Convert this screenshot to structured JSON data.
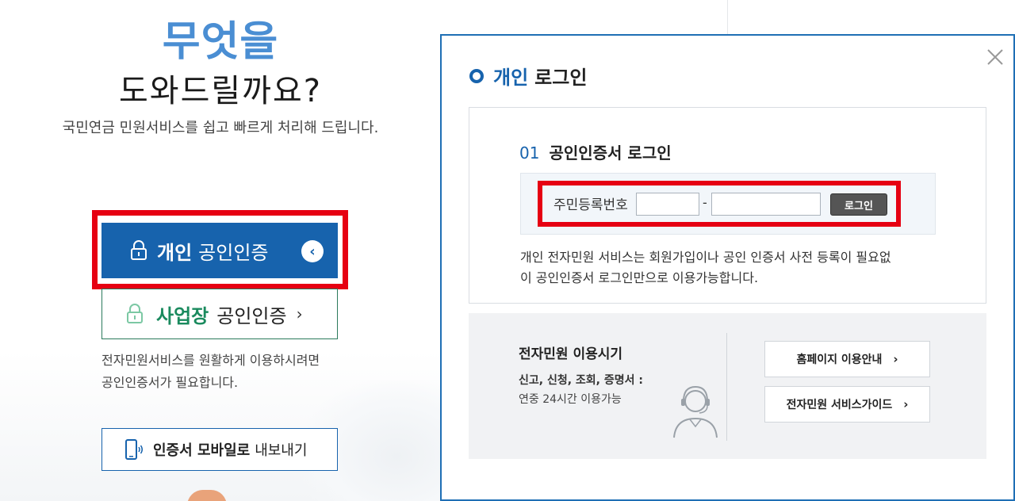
{
  "hero": {
    "title_line1": "무엇을",
    "title_line2": "도와드릴까요?",
    "subtitle": "국민연금 민원서비스를 쉽고 빠르게 처리해 드립니다."
  },
  "buttons": {
    "personal_bold": "개인",
    "personal_label": "공인인증",
    "business_bold": "사업장",
    "business_label": "공인인증",
    "business_chevron": "›",
    "mobile_bold": "인증서 모바일로",
    "mobile_label": "내보내기"
  },
  "left_note": {
    "line1": "전자민원서비스를 원활하게 이용하시려면",
    "line2": "공인인증서가 필요합니다."
  },
  "modal": {
    "title_accent": "개인",
    "title_rest": "로그인",
    "section_number": "01",
    "section_title": "공인인증서 로그인",
    "id_label": "주민등록번호",
    "id_dash": "-",
    "login_button": "로그인",
    "description_line1": "개인 전자민원 서비스는 회원가입이나 공인 인증서 사전 등록이 필요없",
    "description_line2": "이 공인인증서 로그인만으로 이용가능합니다.",
    "id_part1_value": "",
    "id_part2_value": ""
  },
  "info": {
    "title": "전자민원 이용시기",
    "line1": "신고, 신청, 조회, 증명서 :",
    "line2": "연중 24시간 이용가능",
    "guide1": "홈페이지 이용안내",
    "guide2": "전자민원 서비스가이드",
    "chevron": "›"
  },
  "colors": {
    "primary_blue": "#1763ad",
    "hero_blue": "#4a8ed3",
    "green": "#1a8a5e",
    "highlight_red": "#e60012"
  }
}
